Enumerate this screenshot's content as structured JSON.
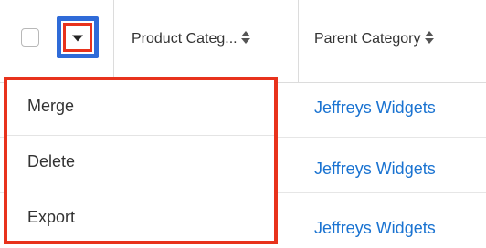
{
  "header": {
    "columns": [
      {
        "label": "Product Categ..."
      },
      {
        "label": "Parent Category"
      }
    ]
  },
  "rows": [
    {
      "parent_category": "Jeffreys Widgets"
    },
    {
      "parent_category": "Jeffreys Widgets"
    },
    {
      "parent_category": "Jeffreys Widgets"
    }
  ],
  "menu": {
    "items": [
      {
        "label": "Merge"
      },
      {
        "label": "Delete"
      },
      {
        "label": "Export"
      }
    ]
  },
  "colors": {
    "highlight_red": "#e8321c",
    "focus_blue": "#2f6bd8",
    "link_blue": "#1a73d1"
  },
  "icons": [
    "checkbox",
    "dropdown-caret-icon",
    "sort-icon"
  ]
}
